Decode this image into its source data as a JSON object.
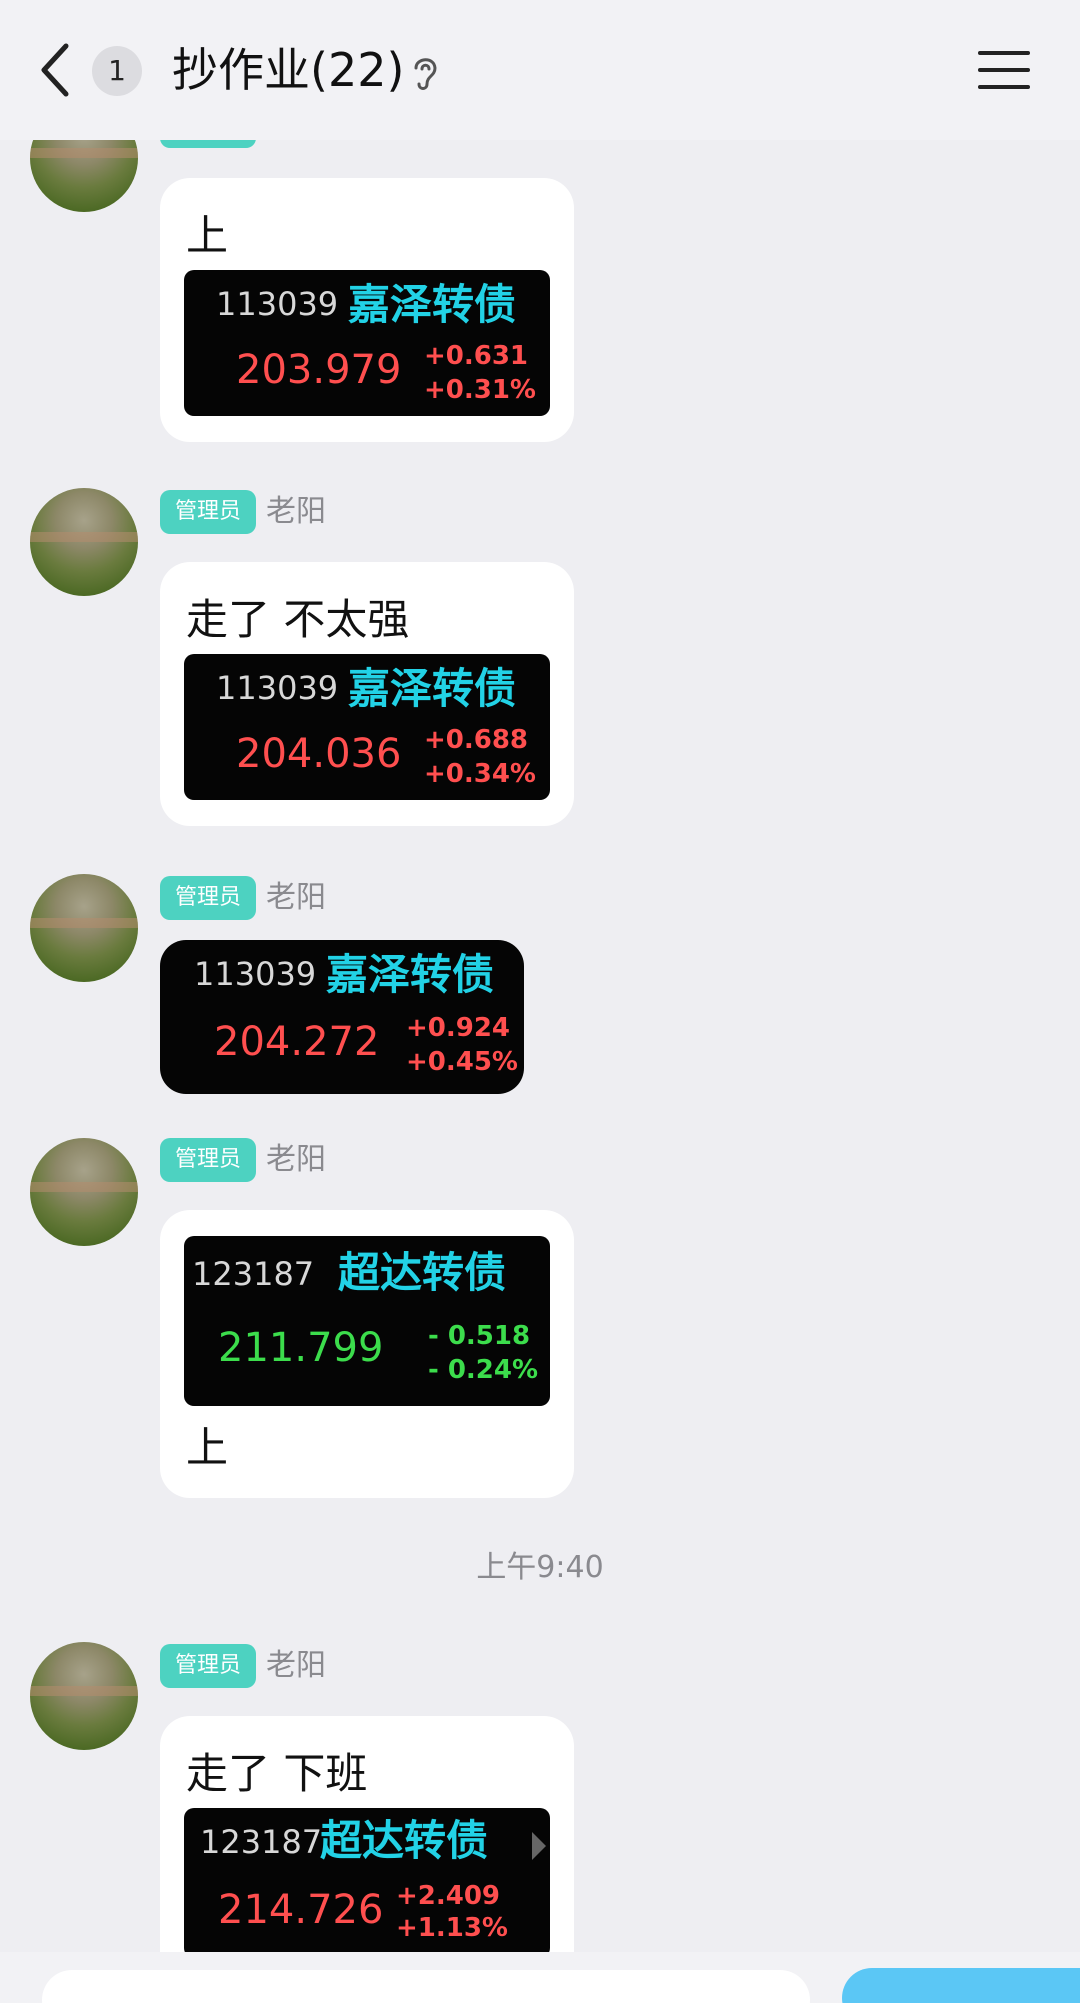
{
  "header": {
    "unread_count": "1",
    "title": "抄作业(22)",
    "icons": [
      "back-icon",
      "ear-icon",
      "menu-icon"
    ]
  },
  "messages": [
    {
      "sender": "老阳",
      "role": "管理员",
      "text_before": "上",
      "quote": {
        "code": "113039",
        "name": "嘉泽转债",
        "price": "203.979",
        "change": "+0.631",
        "pct": "+0.31%"
      }
    },
    {
      "sender": "老阳",
      "role": "管理员",
      "text_before": "走了 不太强",
      "quote": {
        "code": "113039",
        "name": "嘉泽转债",
        "price": "204.036",
        "change": "+0.688",
        "pct": "+0.34%"
      }
    },
    {
      "sender": "老阳",
      "role": "管理员",
      "quote": {
        "code": "113039",
        "name": "嘉泽转债",
        "price": "204.272",
        "change": "+0.924",
        "pct": "+0.45%"
      }
    },
    {
      "sender": "老阳",
      "role": "管理员",
      "text_after": "上",
      "quote": {
        "code": "123187",
        "name": "超达转债",
        "price": "211.799",
        "change": "- 0.518",
        "pct": "- 0.24%"
      }
    },
    {
      "sender": "老阳",
      "role": "管理员",
      "text_before": "走了  下班",
      "quote": {
        "code": "123187",
        "name": "超达转债",
        "price": "214.726",
        "change": "+2.409",
        "pct": "+1.13%"
      }
    }
  ],
  "time_separator": "上午9:40",
  "colors": {
    "background": "#eeeef2",
    "role_badge": "#4dd2c1",
    "quote_name": "#22d2e6",
    "price_up": "#ff4f4f",
    "price_down": "#3cdd4c",
    "send_button": "#5bc7f5"
  }
}
